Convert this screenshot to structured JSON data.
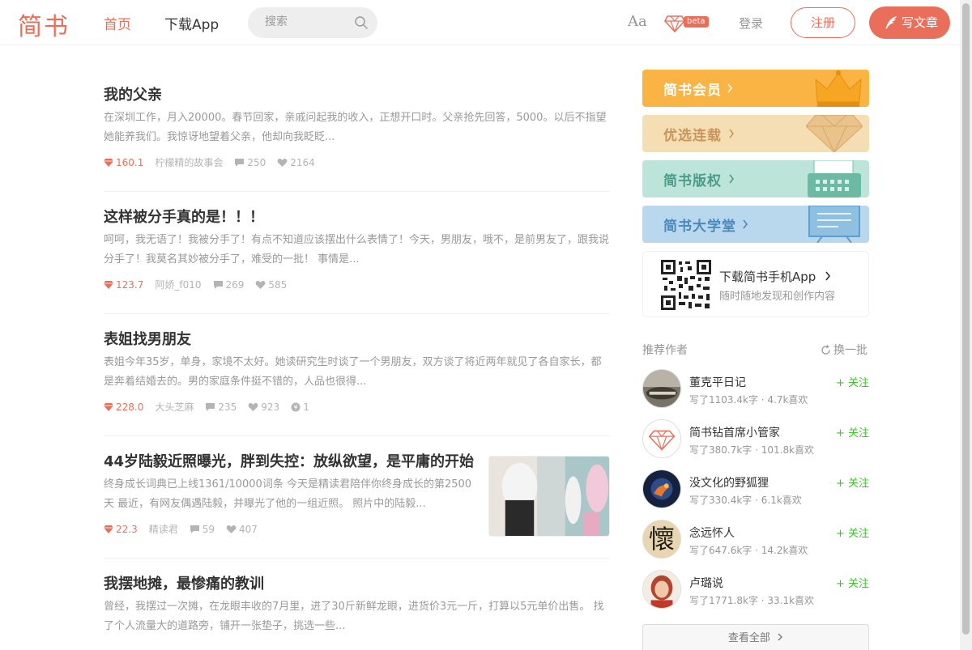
{
  "header": {
    "logo": "简书",
    "nav_home": "首页",
    "nav_app": "下载App",
    "search_placeholder": "搜索",
    "font_toggle": "Aa",
    "beta": "beta",
    "login": "登录",
    "register": "注册",
    "write": "写文章",
    "accent_color": "#ea6f5a"
  },
  "articles": [
    {
      "title": "我的父亲",
      "abstract": "在深圳工作，月入20000。春节回家，亲戚问起我的收入，正想开口时。父亲抢先回答，5000。以后不指望她能养我们。我惊讶地望着父亲，他却向我眨眨...",
      "jsd": "160.1",
      "author": "柠檬精的故事会",
      "comments": "250",
      "likes": "2164"
    },
    {
      "title": "这样被分手真的是！！！",
      "abstract": "呵呵，我无语了！我被分手了！有点不知道应该摆出什么表情了！今天，男朋友，哦不，是前男友了，跟我说分手了！我莫名其妙被分手了，难受的一批！ 事情是...",
      "jsd": "123.7",
      "author": "阿娇_f010",
      "comments": "269",
      "likes": "585"
    },
    {
      "title": "表姐找男朋友",
      "abstract": "表姐今年35岁，单身，家境不太好。她读研究生时谈了一个男朋友，双方谈了将近两年就见了各自家长，都是奔着结婚去的。男的家庭条件挺不错的，人品也很得...",
      "jsd": "228.0",
      "author": "大头芝麻",
      "comments": "235",
      "likes": "923",
      "rewards": "1"
    },
    {
      "title": "44岁陆毅近照曝光，胖到失控：放纵欲望，是平庸的开始",
      "abstract": "终身成长词典已上线1361/10000词条 今天是精读君陪伴你终身成长的第2500天 最近，有网友偶遇陆毅，并曝光了他的一组近照。 照片中的陆毅...",
      "jsd": "22.3",
      "author": "精读君",
      "comments": "59",
      "likes": "407"
    },
    {
      "title": "我摆地摊，最惨痛的教训",
      "abstract": "曾经，我摆过一次摊，在龙眼丰收的7月里，进了30斤新鲜龙眼，进货价3元一斤，打算以5元单价出售。 找了个人流量大的道路旁，铺开一张垫子，挑选一些...",
      "jsd": "",
      "author": "",
      "comments": "",
      "likes": ""
    }
  ],
  "sidebar": {
    "boards": [
      {
        "label": "简书会员",
        "color": "#f9b443"
      },
      {
        "label": "优选连载",
        "color": "#f5deb3"
      },
      {
        "label": "简书版权",
        "color": "#bde4d9"
      },
      {
        "label": "简书大学堂",
        "color": "#b9d7ed"
      }
    ],
    "download_title": "下载简书手机App",
    "download_sub": "随时随地发现和创作内容",
    "recommend_title": "推荐作者",
    "refresh": "换一批",
    "authors": [
      {
        "name": "董克平日记",
        "stats": "写了1103.4k字 · 4.7k喜欢",
        "follow": "关注"
      },
      {
        "name": "简书钻首席小管家",
        "stats": "写了380.7k字 · 101.8k喜欢",
        "follow": "关注"
      },
      {
        "name": "没文化的野狐狸",
        "stats": "写了330.4k字 · 6.1k喜欢",
        "follow": "关注"
      },
      {
        "name": "念远怀人",
        "stats": "写了647.6k字 · 14.2k喜欢",
        "follow": "关注",
        "avatar_glyph": "懷"
      },
      {
        "name": "卢璐说",
        "stats": "写了1771.8k字 · 33.1k喜欢",
        "follow": "关注"
      }
    ],
    "view_all": "查看全部"
  }
}
